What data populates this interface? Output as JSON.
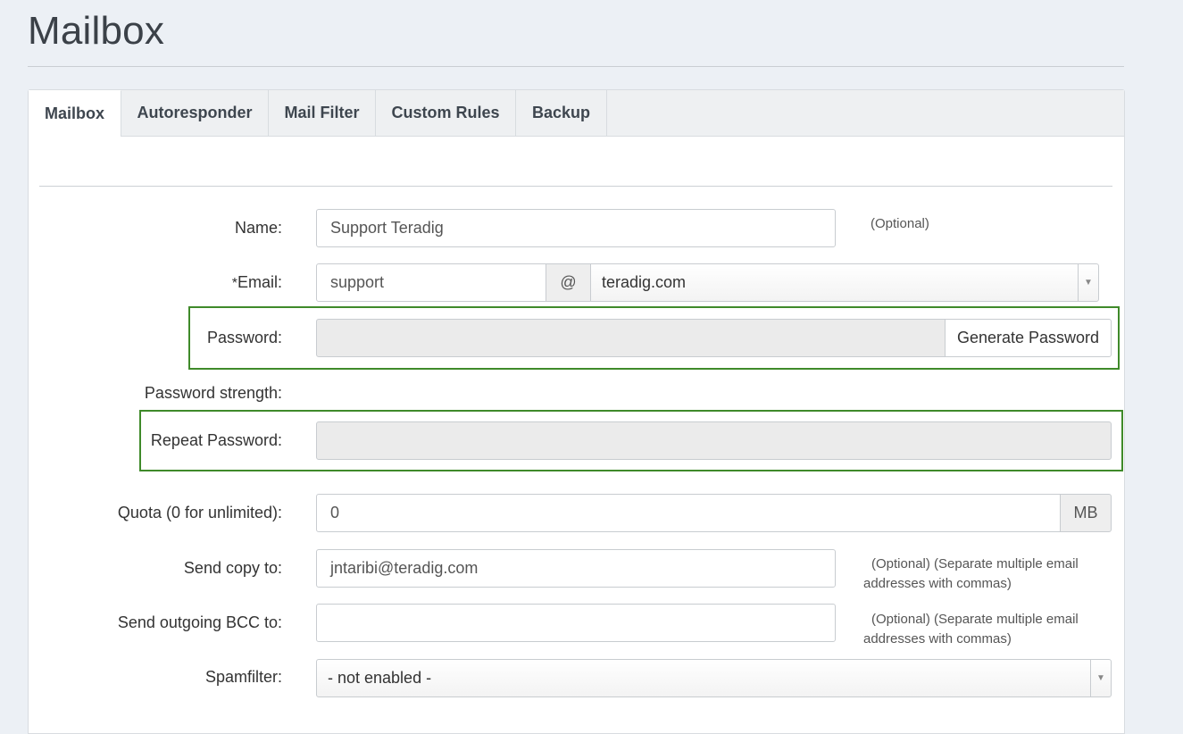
{
  "page": {
    "title": "Mailbox"
  },
  "tabs": [
    {
      "label": "Mailbox",
      "active": true
    },
    {
      "label": "Autoresponder"
    },
    {
      "label": "Mail Filter"
    },
    {
      "label": "Custom Rules"
    },
    {
      "label": "Backup"
    }
  ],
  "form": {
    "name": {
      "label": "Name:",
      "value": "Support Teradig",
      "hint": "(Optional)"
    },
    "email": {
      "required_mark": "*",
      "label": "Email:",
      "local": "support",
      "at": "@",
      "domain": "teradig.com"
    },
    "password": {
      "label": "Password:",
      "value": "",
      "generate_label": "Generate Password"
    },
    "strength": {
      "label": "Password strength:"
    },
    "repeat_password": {
      "label": "Repeat Password:",
      "value": ""
    },
    "quota": {
      "label": "Quota (0 for unlimited):",
      "value": "0",
      "unit": "MB"
    },
    "send_copy": {
      "label": "Send copy to:",
      "value": "jntaribi@teradig.com",
      "hint_line1": "(Optional) (Separate multiple email",
      "hint_line2": "addresses with commas)"
    },
    "bcc": {
      "label": "Send outgoing BCC to:",
      "value": "",
      "hint_line1": "(Optional) (Separate multiple email",
      "hint_line2": "addresses with commas)"
    },
    "spamfilter": {
      "label": "Spamfilter:",
      "value": "- not enabled -"
    }
  },
  "colors": {
    "highlight": "#3f8a2a",
    "background": "#ecf0f5"
  }
}
